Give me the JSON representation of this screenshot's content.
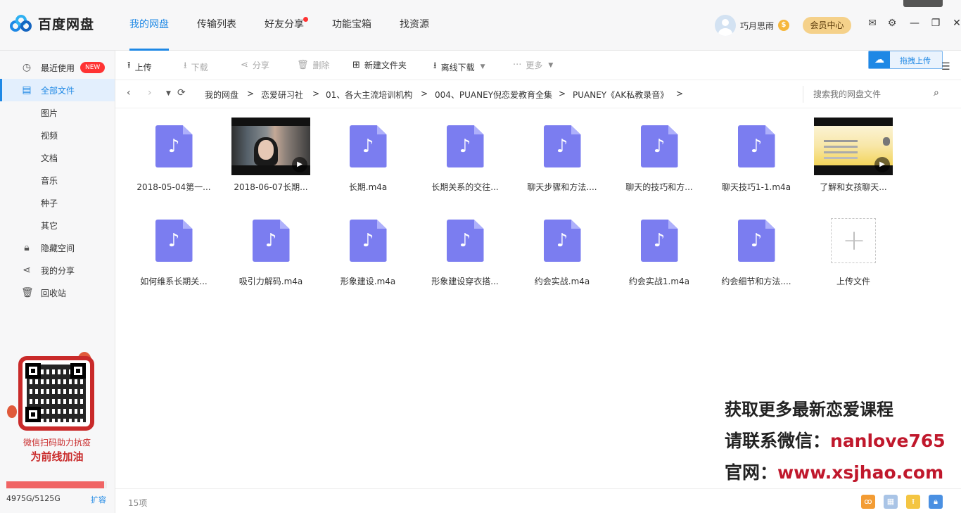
{
  "app": {
    "name": "百度网盘"
  },
  "nav": {
    "tabs": [
      {
        "label": "我的网盘"
      },
      {
        "label": "传输列表"
      },
      {
        "label": "好友分享"
      },
      {
        "label": "功能宝箱"
      },
      {
        "label": "找资源"
      }
    ]
  },
  "user": {
    "name": "巧月思雨",
    "coin": "$",
    "vip_label": "会员中心"
  },
  "sidebar": {
    "items": [
      {
        "label": "最近使用",
        "badge": "NEW"
      },
      {
        "label": "全部文件"
      },
      {
        "label": "图片"
      },
      {
        "label": "视频"
      },
      {
        "label": "文档"
      },
      {
        "label": "音乐"
      },
      {
        "label": "种子"
      },
      {
        "label": "其它"
      },
      {
        "label": "隐藏空间"
      },
      {
        "label": "我的分享"
      },
      {
        "label": "回收站"
      }
    ],
    "promo_line1": "微信扫码助力抗疫",
    "promo_line2": "为前线加油",
    "storage_text": "4975G/5125G",
    "storage_used_fraction": 0.971,
    "expand_label": "扩容"
  },
  "toolbar": {
    "upload": "上传",
    "download": "下载",
    "share": "分享",
    "delete": "删除",
    "new_folder": "新建文件夹",
    "offline_download": "离线下载",
    "more": "更多",
    "drag_upload": "拖拽上传"
  },
  "breadcrumb": [
    "我的网盘",
    "恋爱研习社",
    "01、各大主流培训机构",
    "004、PUANEY倪恋爱教育全集",
    "PUANEY《AK私教录音》"
  ],
  "search": {
    "placeholder": "搜索我的网盘文件"
  },
  "files": [
    {
      "name": "2018-05-04第一..."
    },
    {
      "name": "2018-06-07长期..."
    },
    {
      "name": "长期.m4a"
    },
    {
      "name": "长期关系的交往..."
    },
    {
      "name": "聊天步骤和方法...."
    },
    {
      "name": "聊天的技巧和方..."
    },
    {
      "name": "聊天技巧1-1.m4a"
    },
    {
      "name": "了解和女孩聊天..."
    },
    {
      "name": "如何维系长期关..."
    },
    {
      "name": "吸引力解码.m4a"
    },
    {
      "name": "形象建设.m4a"
    },
    {
      "name": "形象建设穿衣搭..."
    },
    {
      "name": "约会实战.m4a"
    },
    {
      "name": "约会实战1.m4a"
    },
    {
      "name": "约会细节和方法...."
    },
    {
      "name": "上传文件"
    }
  ],
  "watermark": {
    "line1": "获取更多最新恋爱课程",
    "line2_key": "请联系微信：",
    "line2_value": "nanlove765",
    "line3_key": "官网：",
    "line3_value": "www.xsjhao.com"
  },
  "status": {
    "count": "15项"
  },
  "colors": {
    "accent": "#1e88e5",
    "audio_icon": "#7b7df0",
    "promo_red": "#c92a2a"
  }
}
